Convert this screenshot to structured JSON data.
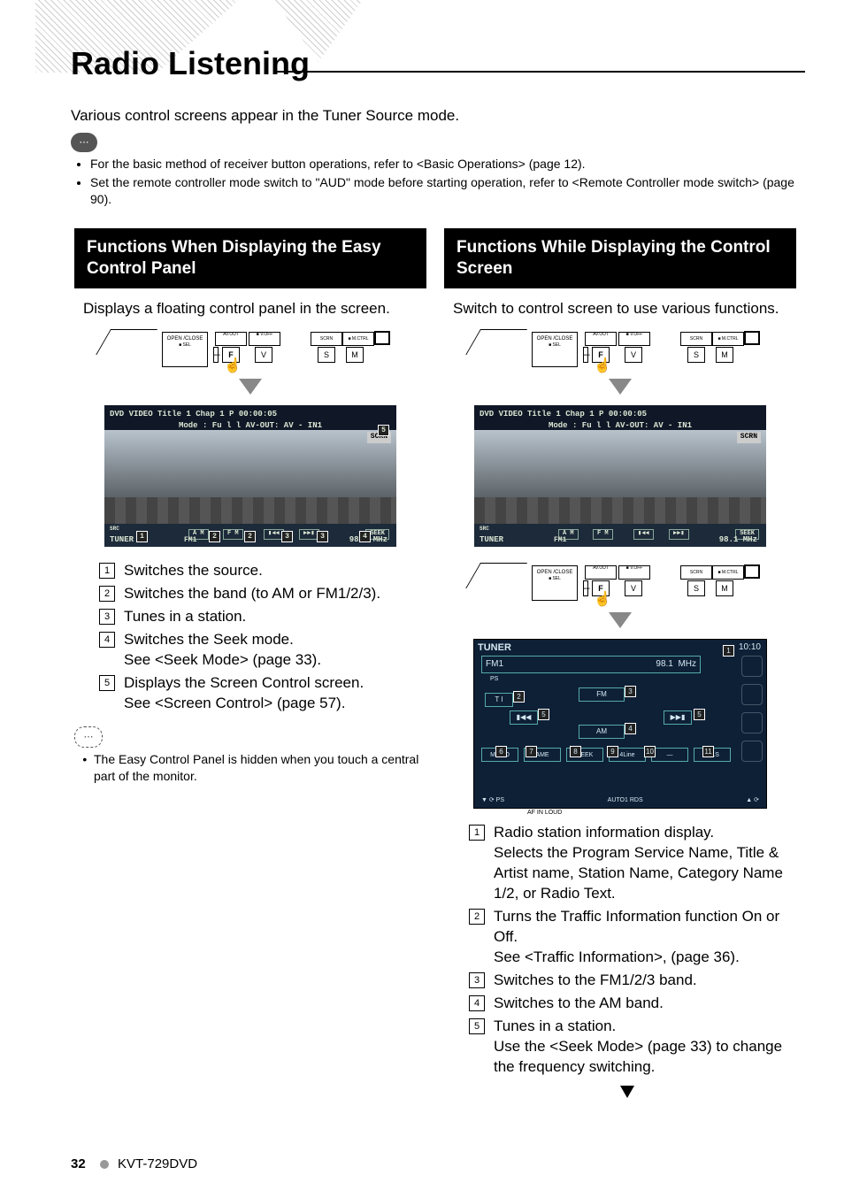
{
  "page_title": "Radio Listening",
  "intro": "Various control screens appear in the Tuner Source mode.",
  "notes": [
    "For the basic method of receiver button operations, refer to <Basic Operations> (page 12).",
    "Set the remote controller mode switch to \"AUD\" mode before starting operation, refer to <Remote Controller mode switch> (page 90)."
  ],
  "left": {
    "heading": "Functions When Displaying the Easy Control Panel",
    "sub": "Displays a floating control panel in the screen.",
    "list": [
      "Switches the source.",
      "Switches the band (to AM or FM1/2/3).",
      "Tunes in a station.",
      "Switches the Seek mode.\nSee <Seek Mode> (page 33).",
      "Displays the Screen Control screen.\nSee <Screen Control> (page 57)."
    ],
    "dash_note": "The Easy Control Panel is hidden when you touch a central part of the monitor."
  },
  "right": {
    "heading": "Functions While Displaying the Control Screen",
    "sub": "Switch to control screen to use various functions.",
    "list": [
      "Radio station information display.\nSelects the Program Service Name, Title & Artist name, Station Name, Category Name 1/2, or Radio Text.",
      "Turns the Traffic Information function On or Off.\nSee <Traffic Information>, (page 36).",
      "Switches to the FM1/2/3 band.",
      "Switches to the AM band.",
      "Tunes in a station.\nUse the <Seek Mode> (page 33) to change the frequency switching."
    ]
  },
  "ctrlbar": {
    "open": "OPEN\n/CLOSE",
    "sel": "■ SEL",
    "avout": "AV.OUT",
    "voff": "■ V.OFF",
    "f": "F",
    "v": "V",
    "scrn": "SCRN",
    "mctrl": "■ M.CTRL",
    "s": "S",
    "m": "M"
  },
  "screen": {
    "topline": "DVD VIDEO    Title   1     Chap      1     P  00:00:05",
    "mode": "Mode :  Fu l l        AV-OUT: AV - IN1",
    "scrn_btn": "SCRN",
    "src": "SRC",
    "tuner": "TUNER",
    "am": "A M",
    "fm": "F M",
    "prev": "▮◀◀",
    "next": "▶▶▮",
    "seek": "SEEK",
    "fm1": "FM1",
    "freq": "98.1  MHz",
    "callout5": "5"
  },
  "tuner": {
    "hdr": "TUNER",
    "clock": "10:10",
    "band": "FM1",
    "freq": "98.1",
    "unit": "MHz",
    "ps": "PS",
    "ti": "T I",
    "fm": "FM",
    "am": "AM",
    "prev": "▮◀◀",
    "next": "▶▶▮",
    "low": [
      "MONO",
      "AME",
      "SEEK",
      "4Line",
      "—",
      "LO.S"
    ],
    "status_l": "▼ ⟳  PS",
    "status_c": "AUTO1        RDS",
    "status_r": "▲ ⟳",
    "af": "AF          IN                                 LOUD"
  },
  "footer": {
    "page": "32",
    "model": "KVT-729DVD"
  }
}
